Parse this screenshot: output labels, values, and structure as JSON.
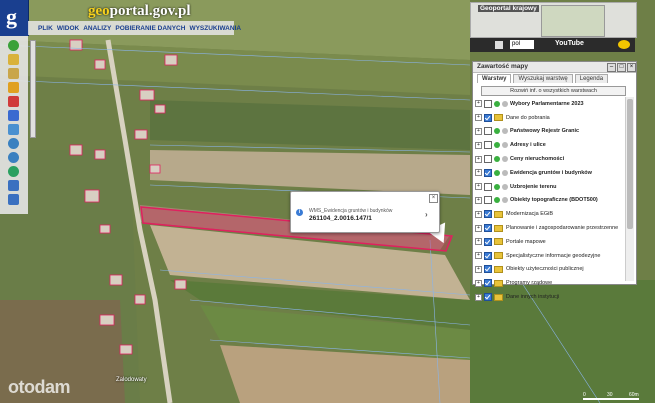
{
  "header": {
    "brand_prefix": "geo",
    "brand_suffix": "portal.gov.pl",
    "menu": [
      "PLIK",
      "WIDOK",
      "ANALIZY",
      "POBIERANIE DANYCH",
      "WYSZUKIWANIA"
    ]
  },
  "overview": {
    "title": "Geoportal krajowy"
  },
  "topbar": {
    "language": "pol",
    "youtube_label": "YouTube"
  },
  "panel": {
    "title": "Zawartość mapy",
    "tabs": [
      "Warstwy",
      "Wyszukaj warstwę",
      "Legenda"
    ],
    "active_tab": "Warstwy",
    "expand_button": "Rozwiń inf. o wszystkich warstwach",
    "layers": [
      {
        "label": "Wybory Parlamentarne 2023",
        "bold": true,
        "checked": false,
        "type": "service"
      },
      {
        "label": "Dane do pobrania",
        "bold": false,
        "checked": true,
        "type": "folder"
      },
      {
        "label": "Państwowy Rejestr Granic",
        "bold": true,
        "checked": false,
        "type": "service"
      },
      {
        "label": "Adresy i ulice",
        "bold": true,
        "checked": false,
        "type": "service"
      },
      {
        "label": "Ceny nieruchomości",
        "bold": true,
        "checked": false,
        "type": "service"
      },
      {
        "label": "Ewidencja gruntów i budynków",
        "bold": true,
        "checked": true,
        "type": "service"
      },
      {
        "label": "Uzbrojenie terenu",
        "bold": true,
        "checked": false,
        "type": "service"
      },
      {
        "label": "Obiekty topograficzne (BDOT500)",
        "bold": true,
        "checked": false,
        "type": "service"
      },
      {
        "label": "Modernizacja EGiB",
        "bold": false,
        "checked": true,
        "type": "folder"
      },
      {
        "label": "Planowanie i zagospodarowanie przestrzenne",
        "bold": false,
        "checked": true,
        "type": "folder"
      },
      {
        "label": "Portale mapowe",
        "bold": false,
        "checked": true,
        "type": "folder"
      },
      {
        "label": "Specjalistyczne informacje geodezyjne",
        "bold": false,
        "checked": true,
        "type": "folder"
      },
      {
        "label": "Obiekty użyteczności publicznej",
        "bold": false,
        "checked": true,
        "type": "folder"
      },
      {
        "label": "Programy rządowe",
        "bold": false,
        "checked": true,
        "type": "folder"
      },
      {
        "label": "Dane innych instytucji",
        "bold": false,
        "checked": true,
        "type": "folder"
      }
    ]
  },
  "popup": {
    "label": "WMS_Ewidencja gruntów i budynków",
    "value": "261104_2.0016.147/1"
  },
  "footer": {
    "watermark": "otodam",
    "street": "Zalodowaty",
    "scale_labels": [
      "0",
      "30",
      "60m"
    ]
  },
  "colors": {
    "parcel_highlight": "#e0205f",
    "brand_blue": "#1a3f8f",
    "brand_yellow": "#f7d21d"
  }
}
